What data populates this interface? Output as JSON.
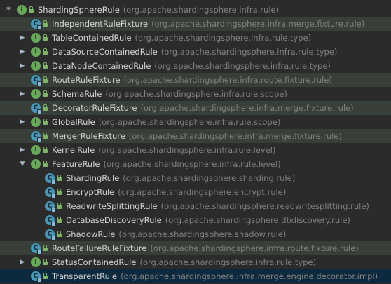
{
  "tree": {
    "rows": [
      {
        "name": "ShardingSphereRule",
        "pkg": "(org.apache.shardingsphere.infra.rule)",
        "kind": "interface",
        "arrow": "star",
        "level": 0,
        "highlight": false,
        "selected": false
      },
      {
        "name": "IndependentRuleFixture",
        "pkg": "(org.apache.shardingsphere.infra.merge.fixture.rule)",
        "kind": "class",
        "arrow": "none",
        "level": 1,
        "highlight": true,
        "selected": false
      },
      {
        "name": "TableContainedRule",
        "pkg": "(org.apache.shardingsphere.infra.rule.type)",
        "kind": "interface",
        "arrow": "collapsed",
        "level": 1,
        "highlight": false,
        "selected": false
      },
      {
        "name": "DataSourceContainedRule",
        "pkg": "(org.apache.shardingsphere.infra.rule.type)",
        "kind": "interface",
        "arrow": "collapsed",
        "level": 1,
        "highlight": false,
        "selected": false
      },
      {
        "name": "DataNodeContainedRule",
        "pkg": "(org.apache.shardingsphere.infra.rule.type)",
        "kind": "interface",
        "arrow": "collapsed",
        "level": 1,
        "highlight": false,
        "selected": false
      },
      {
        "name": "RouteRuleFixture",
        "pkg": "(org.apache.shardingsphere.infra.route.fixture.rule)",
        "kind": "class",
        "arrow": "none",
        "level": 1,
        "highlight": true,
        "selected": false
      },
      {
        "name": "SchemaRule",
        "pkg": "(org.apache.shardingsphere.infra.rule.scope)",
        "kind": "interface",
        "arrow": "collapsed",
        "level": 1,
        "highlight": false,
        "selected": false
      },
      {
        "name": "DecoratorRuleFixture",
        "pkg": "(org.apache.shardingsphere.infra.merge.fixture.rule)",
        "kind": "class",
        "arrow": "none",
        "level": 1,
        "highlight": true,
        "selected": false
      },
      {
        "name": "GlobalRule",
        "pkg": "(org.apache.shardingsphere.infra.rule.scope)",
        "kind": "interface",
        "arrow": "collapsed",
        "level": 1,
        "highlight": false,
        "selected": false
      },
      {
        "name": "MergerRuleFixture",
        "pkg": "(org.apache.shardingsphere.infra.merge.fixture.rule)",
        "kind": "class",
        "arrow": "none",
        "level": 1,
        "highlight": true,
        "selected": false
      },
      {
        "name": "KernelRule",
        "pkg": "(org.apache.shardingsphere.infra.rule.level)",
        "kind": "interface",
        "arrow": "collapsed",
        "level": 1,
        "highlight": false,
        "selected": false
      },
      {
        "name": "FeatureRule",
        "pkg": "(org.apache.shardingsphere.infra.rule.level)",
        "kind": "interface",
        "arrow": "expanded",
        "level": 1,
        "highlight": false,
        "selected": false
      },
      {
        "name": "ShardingRule",
        "pkg": "(org.apache.shardingsphere.sharding.rule)",
        "kind": "class",
        "arrow": "none",
        "level": 2,
        "highlight": false,
        "selected": false
      },
      {
        "name": "EncryptRule",
        "pkg": "(org.apache.shardingsphere.encrypt.rule)",
        "kind": "class",
        "arrow": "none",
        "level": 2,
        "highlight": false,
        "selected": false
      },
      {
        "name": "ReadwriteSplittingRule",
        "pkg": "(org.apache.shardingsphere.readwritesplitting.rule)",
        "kind": "class",
        "arrow": "none",
        "level": 2,
        "highlight": false,
        "selected": false
      },
      {
        "name": "DatabaseDiscoveryRule",
        "pkg": "(org.apache.shardingsphere.dbdiscovery.rule)",
        "kind": "class",
        "arrow": "none",
        "level": 2,
        "highlight": false,
        "selected": false
      },
      {
        "name": "ShadowRule",
        "pkg": "(org.apache.shardingsphere.shadow.rule)",
        "kind": "class",
        "arrow": "none",
        "level": 2,
        "highlight": false,
        "selected": false
      },
      {
        "name": "RouteFailureRuleFixture",
        "pkg": "(org.apache.shardingsphere.infra.route.fixture.rule)",
        "kind": "class",
        "arrow": "none",
        "level": 1,
        "highlight": true,
        "selected": false
      },
      {
        "name": "StatusContainedRule",
        "pkg": "(org.apache.shardingsphere.infra.rule.type)",
        "kind": "interface",
        "arrow": "collapsed",
        "level": 1,
        "highlight": false,
        "selected": false
      },
      {
        "name": "TransparentRule",
        "pkg": "(org.apache.shardingsphere.infra.merge.engine.decorator.impl)",
        "kind": "class",
        "arrow": "none",
        "level": 1,
        "highlight": false,
        "selected": true
      }
    ],
    "glyphs": {
      "star": "*",
      "collapsed": "▶",
      "expanded": "▼",
      "interface": "I",
      "class": "C"
    },
    "colors": {
      "interface": "#69a85a",
      "class": "#4996b5",
      "highlight": "#373f38",
      "selected": "#0d293e",
      "package": "#808080"
    }
  }
}
